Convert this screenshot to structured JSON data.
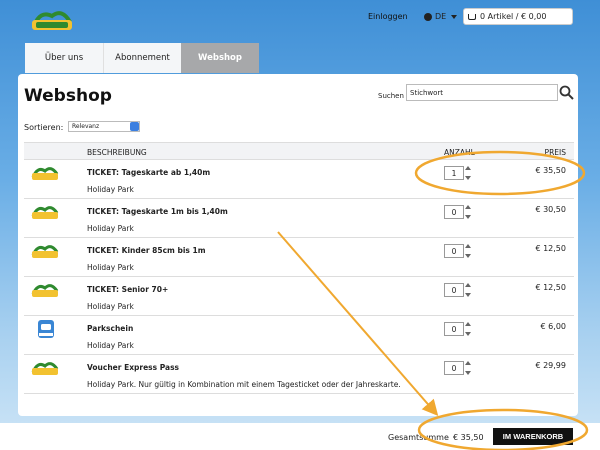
{
  "header": {
    "login_label": "Einloggen",
    "language": "DE",
    "cart_summary": "0 Artikel / € 0,00"
  },
  "tabs": [
    {
      "label": "Über uns"
    },
    {
      "label": "Abonnement"
    },
    {
      "label": "Webshop"
    }
  ],
  "main": {
    "title": "Webshop",
    "search_label": "Suchen",
    "search_value": "Stichwort",
    "sort_label": "Sortieren:",
    "sort_value": "Relevanz"
  },
  "table": {
    "col_description": "BESCHREIBUNG",
    "col_quantity": "ANZAHL",
    "col_price": "PREIS",
    "rows": [
      {
        "name": "TICKET: Tageskarte ab 1,40m",
        "sub": "Holiday Park",
        "qty": "1",
        "price": "€ 35,50",
        "thumb": "holiday-park-logo"
      },
      {
        "name": "TICKET: Tageskarte 1m bis 1,40m",
        "sub": "Holiday Park",
        "qty": "0",
        "price": "€ 30,50",
        "thumb": "holiday-park-logo"
      },
      {
        "name": "TICKET: Kinder 85cm bis 1m",
        "sub": "Holiday Park",
        "qty": "0",
        "price": "€ 12,50",
        "thumb": "holiday-park-logo"
      },
      {
        "name": "TICKET: Senior 70+",
        "sub": "Holiday Park",
        "qty": "0",
        "price": "€ 12,50",
        "thumb": "holiday-park-logo"
      },
      {
        "name": "Parkschein",
        "sub": "Holiday Park",
        "qty": "0",
        "price": "€ 6,00",
        "thumb": "parking-icon"
      },
      {
        "name": "Voucher Express Pass",
        "sub": "Holiday Park. Nur gültig in Kombination mit einem Tagesticket oder der Jahreskarte.",
        "qty": "0",
        "price": "€ 29,99",
        "thumb": "holiday-park-logo"
      }
    ]
  },
  "footer": {
    "total_label": "Gesamtsumme",
    "total_value": "€ 35,50",
    "submit_label": "IM WARENKORB"
  },
  "colors": {
    "accent_annotation": "#f0a830",
    "tab_active": "#a7a8aa",
    "submit_bg": "#111111"
  }
}
